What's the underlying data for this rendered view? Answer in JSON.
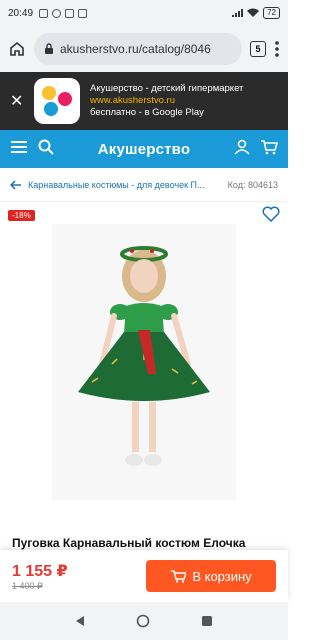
{
  "status": {
    "time": "20:49",
    "battery": "72"
  },
  "browser": {
    "url": "akusherstvo.ru/catalog/8046",
    "tabs": "5"
  },
  "banner": {
    "title": "Акушерство - детский гипермаркет",
    "link": "www.akusherstvo.ru",
    "subtitle": "бесплатно - в Google Play"
  },
  "header": {
    "logo": "Акушерство"
  },
  "breadcrumb": {
    "text": "Карнавальные костюмы - для девочек П...",
    "code": "Код: 804613"
  },
  "product": {
    "discount": "-18%",
    "title": "Пуговка Карнавальный костюм Елочка",
    "price": "1 155 ₽",
    "old_price": "1 400 ₽",
    "cart_label": "В корзину"
  },
  "colors": {
    "brand": "#1a9bd7",
    "cart": "#ff5722",
    "price": "#e53935"
  }
}
